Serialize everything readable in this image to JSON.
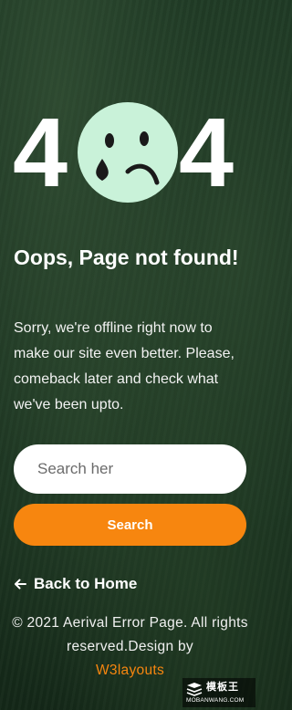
{
  "hero": {
    "digit_left": "4",
    "digit_right": "4",
    "face_icon": "sad-face-icon",
    "face_color": "#c9f2d9"
  },
  "main": {
    "title": "Oops, Page not found!",
    "description": "Sorry, we're offline right now to make our site even better. Please, comeback later and check what we've been upto."
  },
  "search": {
    "placeholder": "Search her",
    "button_label": "Search",
    "button_color": "#f7860f"
  },
  "back_link": {
    "icon": "arrow-left-icon",
    "label": "Back to Home"
  },
  "footer": {
    "text": "© 2021 Aerival Error Page. All rights reserved.Design by",
    "link_label": "W3layouts",
    "link_color": "#f7860f"
  },
  "watermark": {
    "main": "模板王",
    "sub": "MOBANWANG.COM"
  }
}
